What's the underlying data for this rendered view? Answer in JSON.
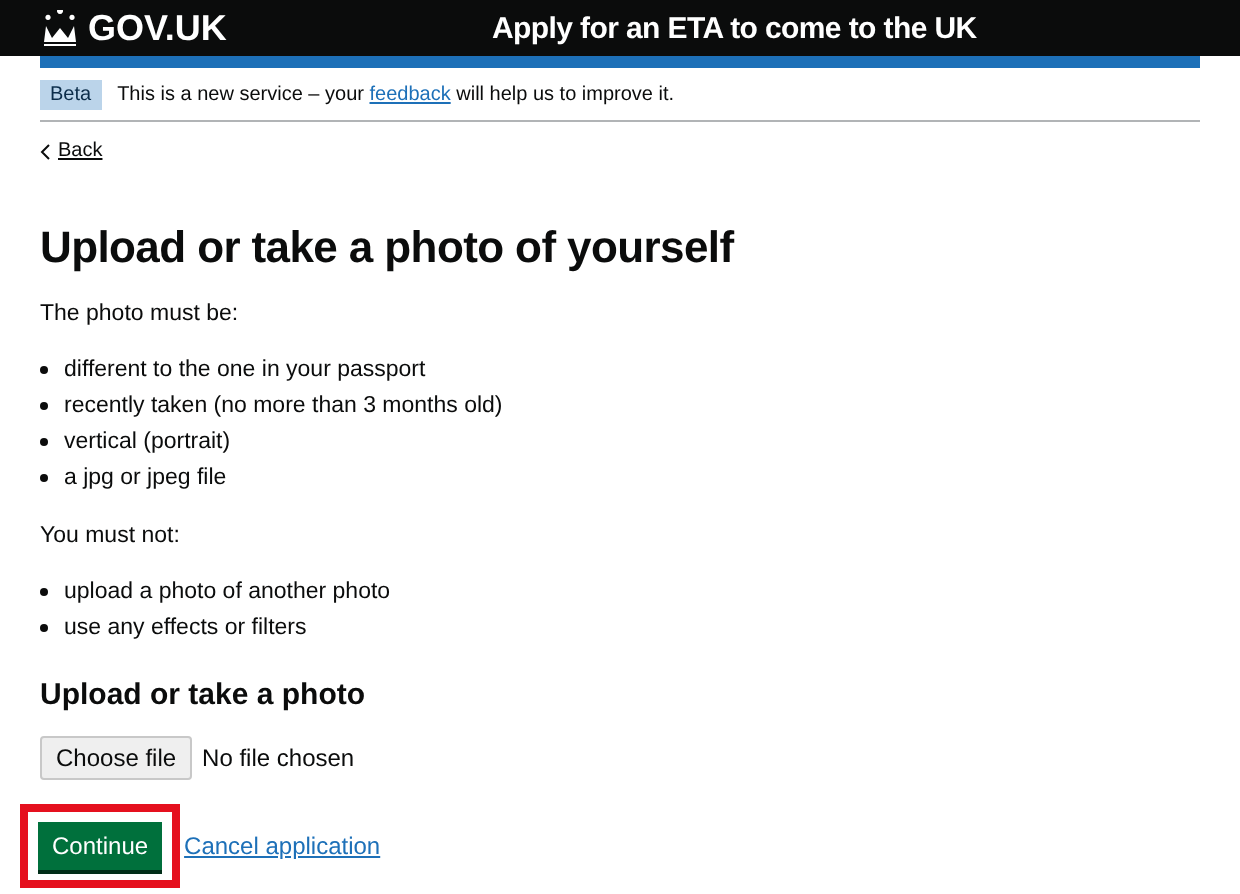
{
  "header": {
    "logo": "GOV.UK",
    "service": "Apply for an ETA to come to the UK"
  },
  "phase_banner": {
    "tag": "Beta",
    "before": "This is a new service – your",
    "link": "feedback",
    "after": "will help us to improve it."
  },
  "back_link": "Back",
  "heading": "Upload or take a photo of yourself",
  "intro": "The photo must be:",
  "must_be": [
    "different to the one in your passport",
    "recently taken (no more than 3 months old)",
    "vertical (portrait)",
    "a jpg or jpeg file"
  ],
  "must_not_intro": "You must not:",
  "must_not": [
    "upload a photo of another photo",
    "use any effects or filters"
  ],
  "upload": {
    "label": "Upload or take a photo",
    "button": "Choose file",
    "status": "No file chosen"
  },
  "continue": {
    "label": "Continue",
    "highlighted": true
  },
  "cancel_link": "Cancel application"
}
